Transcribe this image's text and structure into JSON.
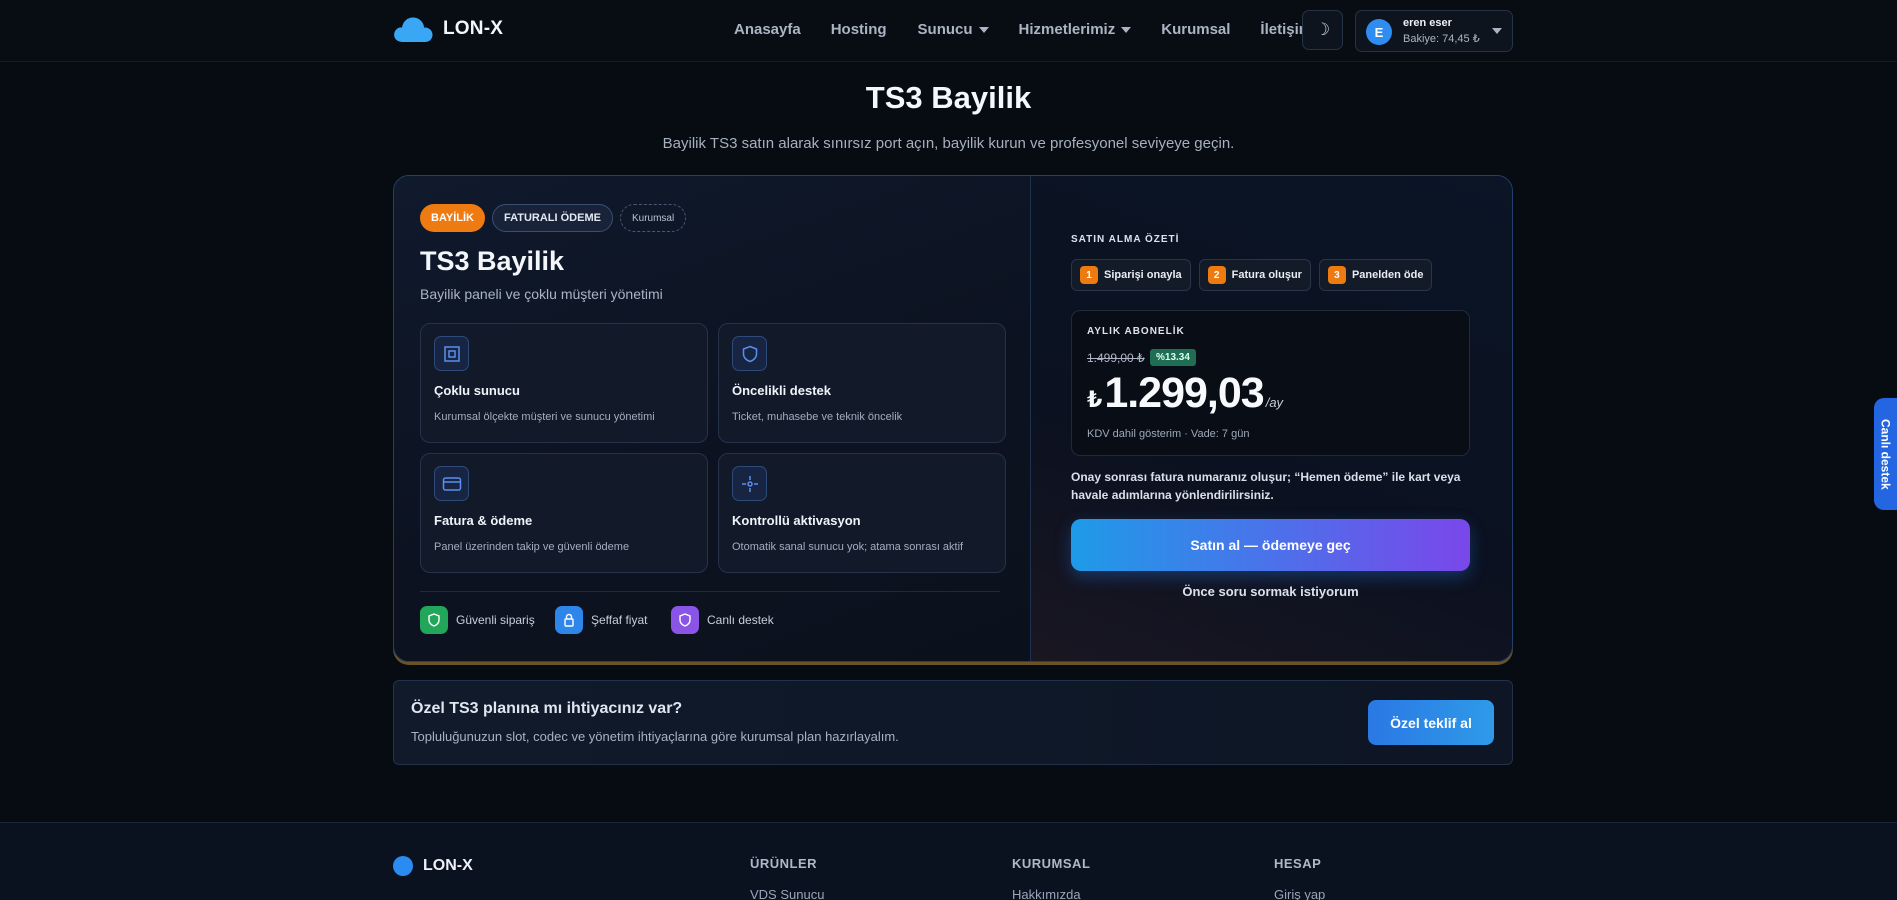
{
  "nav": {
    "brand": "LON-X",
    "links": [
      "Anasayfa",
      "Hosting",
      "Sunucu",
      "Hizmetlerimiz",
      "Kurumsal",
      "İletişim"
    ],
    "theme_icon": "moon-icon",
    "user": {
      "initial": "E",
      "name": "eren eser",
      "balance": "Bakiye: 74,45 ₺"
    }
  },
  "hero": {
    "title": "TS3 Bayilik",
    "subtitle": "Bayilik TS3 satın alarak sınırsız port açın, bayilik kurun ve profesyonel seviyeye geçin."
  },
  "product": {
    "badges": [
      "BAYİLİK",
      "FATURALI ÖDEME",
      "Kurumsal"
    ],
    "title": "TS3 Bayilik",
    "subtitle": "Bayilik paneli ve çoklu müşteri yönetimi",
    "features": [
      {
        "icon": "cpu-icon",
        "title": "Çoklu sunucu",
        "desc": "Kurumsal ölçekte müşteri ve sunucu yönetimi"
      },
      {
        "icon": "shield-icon",
        "title": "Öncelikli destek",
        "desc": "Ticket, muhasebe ve teknik öncelik"
      },
      {
        "icon": "credit-card-icon",
        "title": "Fatura & ödeme",
        "desc": "Panel üzerinden takip ve güvenli ödeme"
      },
      {
        "icon": "crosshair-icon",
        "title": "Kontrollü aktivasyon",
        "desc": "Otomatik sanal sunucu yok; atama sonrası aktif"
      }
    ],
    "trust": [
      {
        "icon": "shield-check-icon",
        "label": "Güvenli sipariş",
        "color": "#22a65a"
      },
      {
        "icon": "lock-icon",
        "label": "Şeffaf fiyat",
        "color": "#2f86ea"
      },
      {
        "icon": "shield-icon",
        "label": "Canlı destek",
        "color": "#8a55e6"
      }
    ]
  },
  "summary": {
    "label": "SATIN ALMA ÖZETİ",
    "steps": [
      {
        "num": "1",
        "label": "Siparişi onayla"
      },
      {
        "num": "2",
        "label": "Fatura oluşur"
      },
      {
        "num": "3",
        "label": "Panelden öde"
      }
    ],
    "plan_label": "AYLIK ABONELİK",
    "old_price": "1.499,00 ₺",
    "discount": "%13.34",
    "currency": "₺",
    "price": "1.299,03",
    "period": "/ay",
    "meta": "KDV dahil gösterim · Vade: 7 gün",
    "note": "Onay sonrası fatura numaranız oluşur; “Hemen ödeme” ile kart veya havale adımlarına yönlendirilirsiniz.",
    "buy_label": "Satın al — ödemeye geç",
    "ask_label": "Önce soru sormak istiyorum"
  },
  "banner": {
    "title": "Özel TS3 planına mı ihtiyacınız var?",
    "subtitle": "Topluluğunuzun slot, codec ve yönetim ihtiyaçlarına göre kurumsal plan hazırlayalım.",
    "button": "Özel teklif al"
  },
  "footer": {
    "brand": "LON-X",
    "columns": [
      {
        "head": "ÜRÜNLER",
        "item": "VDS Sunucu"
      },
      {
        "head": "KURUMSAL",
        "item": "Hakkımızda"
      },
      {
        "head": "HESAP",
        "item": "Giriş yap"
      }
    ]
  },
  "live_support": "Canlı destek",
  "colors": {
    "accent": "#2f8cf0",
    "orange": "#ee7a12",
    "background": "#070b12"
  }
}
